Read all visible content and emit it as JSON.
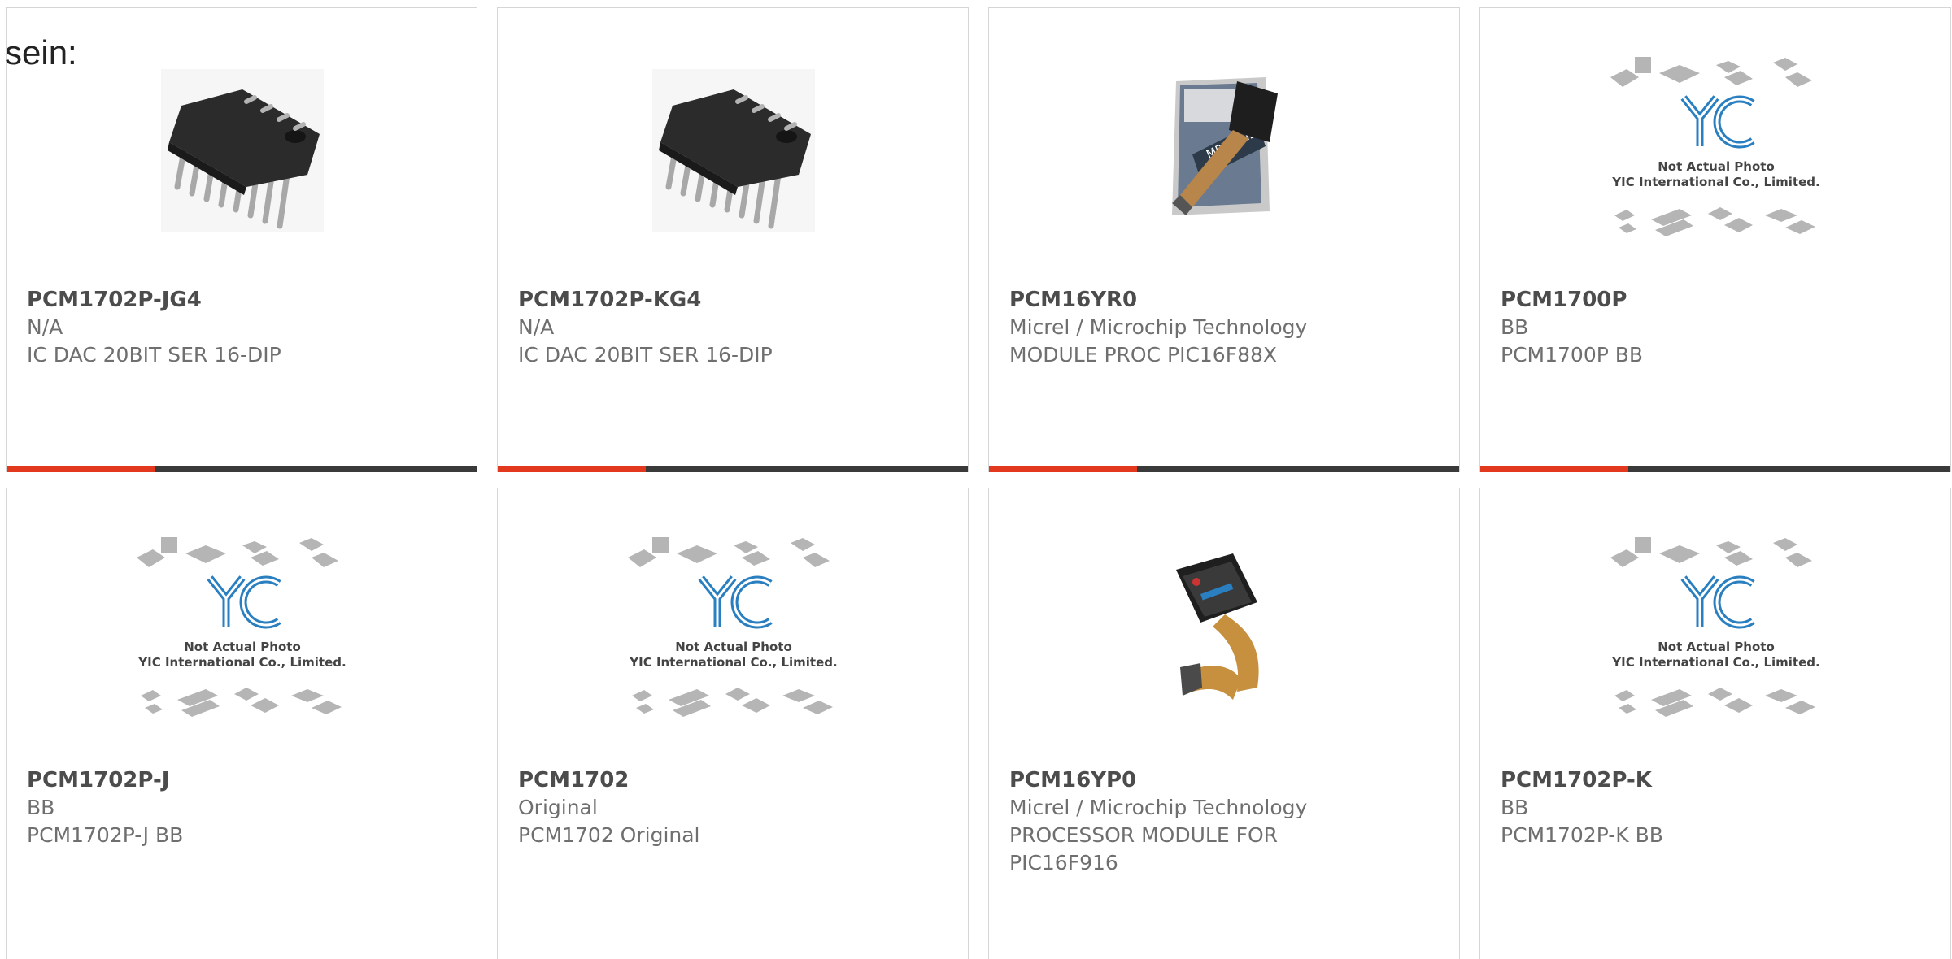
{
  "intro_text": "sein:",
  "products": [
    {
      "part_number": "PCM1702P-JG4",
      "manufacturer": "N/A",
      "description": "IC DAC 20BIT SER 16-DIP",
      "image": "dip16-chip-photo"
    },
    {
      "part_number": "PCM1702P-KG4",
      "manufacturer": "N/A",
      "description": "IC DAC 20BIT SER 16-DIP",
      "image": "dip16-chip-photo"
    },
    {
      "part_number": "PCM16YR0",
      "manufacturer": "Micrel / Microchip Technology",
      "description": "MODULE PROC PIC16F88X",
      "image": "mplab-module-photo"
    },
    {
      "part_number": "PCM1700P",
      "manufacturer": "BB",
      "description": "PCM1700P BB",
      "image": "yic-placeholder"
    },
    {
      "part_number": "PCM1702P-J",
      "manufacturer": "BB",
      "description": "PCM1702P-J BB",
      "image": "yic-placeholder"
    },
    {
      "part_number": "PCM1702",
      "manufacturer": "Original",
      "description": "PCM1702 Original",
      "image": "yic-placeholder"
    },
    {
      "part_number": "PCM16YP0",
      "manufacturer": "Micrel / Microchip Technology",
      "description": "PROCESSOR MODULE FOR PIC16F916",
      "image": "processor-module-photo"
    },
    {
      "part_number": "PCM1702P-K",
      "manufacturer": "BB",
      "description": "PCM1702P-K BB",
      "image": "yic-placeholder"
    }
  ],
  "placeholder": {
    "logo_text": "YIC",
    "line1": "Not Actual Photo",
    "line2": "YIC International Co., Limited."
  },
  "colors": {
    "accent": "#e2381d",
    "bar": "#3a3a3a",
    "text_dark": "#4c4c4c",
    "text_muted": "#6f6f6f",
    "logo_blue": "#2a7fc0"
  }
}
